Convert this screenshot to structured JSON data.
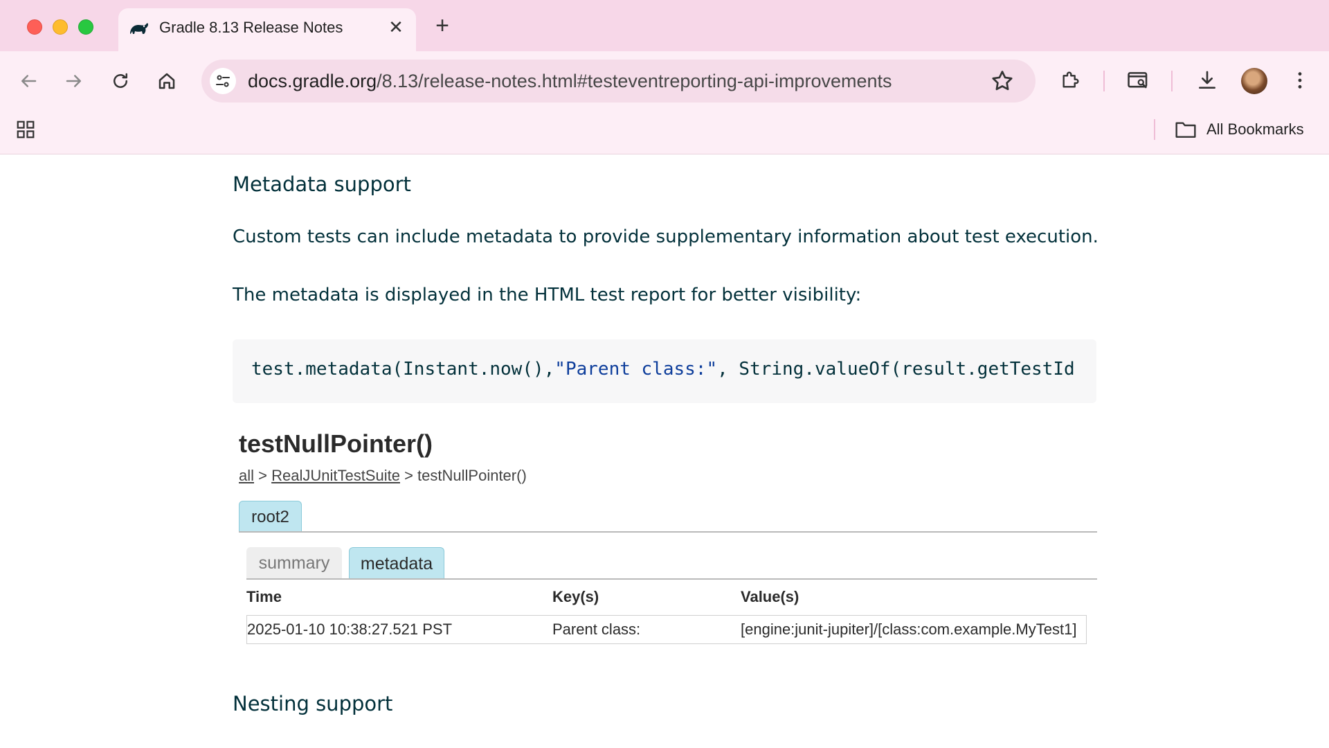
{
  "browser": {
    "tab": {
      "title": "Gradle 8.13 Release Notes",
      "favicon": "gradle-elephant-icon"
    },
    "url": {
      "host": "docs.gradle.org",
      "path": "/8.13/release-notes.html#testeventreporting-api-improvements"
    },
    "bookmarks_bar": {
      "all_bookmarks_label": "All Bookmarks"
    }
  },
  "content": {
    "metadata_heading": "Metadata support",
    "para1": "Custom tests can include metadata to provide supplementary information about test execution.",
    "para2": "The metadata is displayed in the HTML test report for better visibility:",
    "code": {
      "prefix": "test.metadata(Instant.now(),",
      "string": "\"Parent class:\"",
      "suffix": ", String.valueOf(result.getTestId"
    },
    "report": {
      "title": "testNullPointer()",
      "breadcrumb": {
        "all": "all",
        "sep1": " > ",
        "suite": "RealJUnitTestSuite",
        "sep2": " > ",
        "current": "testNullPointer()"
      },
      "root_tab": "root2",
      "tabs": {
        "summary": "summary",
        "metadata": "metadata"
      },
      "table": {
        "headers": {
          "time": "Time",
          "keys": "Key(s)",
          "values": "Value(s)"
        },
        "row": {
          "time": "2025-01-10 10:38:27.521 PST",
          "key": "Parent class:",
          "value": "[engine:junit-jupiter]/[class:com.example.MyTest1]"
        }
      }
    },
    "nesting_heading": "Nesting support"
  }
}
